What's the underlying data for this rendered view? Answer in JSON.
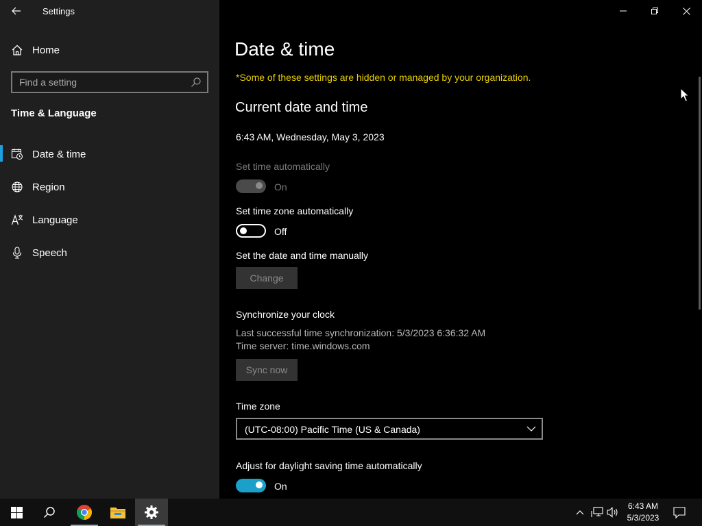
{
  "window": {
    "title": "Settings"
  },
  "nav": {
    "home_label": "Home",
    "search_placeholder": "Find a setting",
    "section_title": "Time & Language",
    "items": [
      {
        "label": "Date & time",
        "icon": "calendar-clock-icon",
        "active": true
      },
      {
        "label": "Region",
        "icon": "globe-icon",
        "active": false
      },
      {
        "label": "Language",
        "icon": "language-icon",
        "active": false
      },
      {
        "label": "Speech",
        "icon": "microphone-icon",
        "active": false
      }
    ]
  },
  "content": {
    "page_title": "Date & time",
    "org_note": "*Some of these settings are hidden or managed by your organization.",
    "current_heading": "Current date and time",
    "current_datetime": "6:43 AM, Wednesday, May 3, 2023",
    "set_time_auto": {
      "label": "Set time automatically",
      "state": "On"
    },
    "set_tz_auto": {
      "label": "Set time zone automatically",
      "state": "Off"
    },
    "manual": {
      "label": "Set the date and time manually",
      "button": "Change"
    },
    "sync": {
      "heading": "Synchronize your clock",
      "last_sync": "Last successful time synchronization: 5/3/2023 6:36:32 AM",
      "server": "Time server: time.windows.com",
      "button": "Sync now"
    },
    "timezone": {
      "label": "Time zone",
      "value": "(UTC-08:00) Pacific Time (US & Canada)"
    },
    "dst": {
      "label": "Adjust for daylight saving time automatically",
      "state": "On"
    }
  },
  "taskbar": {
    "time": "6:43 AM",
    "date": "5/3/2023",
    "accent": "#1ba1c9"
  }
}
